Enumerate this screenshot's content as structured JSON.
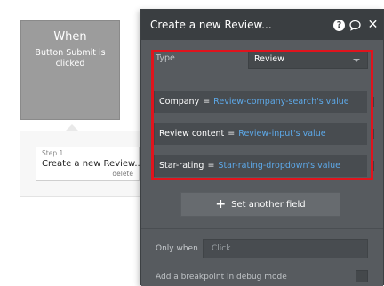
{
  "workflow": {
    "event_title": "When",
    "event_subtitle": "Button Submit is clicked",
    "step_label": "Step 1",
    "step_name": "Create a new Review...",
    "step_delete": "delete"
  },
  "panel": {
    "title": "Create a new Review...",
    "type_label": "Type",
    "type_value": "Review",
    "fields": [
      {
        "name": "Company",
        "eq": "=",
        "value": "Review-company-search's value"
      },
      {
        "name": "Review content",
        "eq": "=",
        "value": "Review-input's value"
      },
      {
        "name": "Star-rating",
        "eq": "=",
        "value": "Star-rating-dropdown's value"
      }
    ],
    "set_field_label": "Set another field",
    "only_when_label": "Only when",
    "only_when_placeholder": "Click",
    "breakpoint_label": "Add a breakpoint in debug mode"
  },
  "icons": {
    "help": "help-icon",
    "comment": "comment-icon",
    "close": "close-icon",
    "plus": "plus-icon"
  },
  "colors": {
    "panel_bg": "#575b5f",
    "header_bg": "#3a3e41",
    "value_blue": "#5da9e9",
    "highlight_red": "#e0141d"
  }
}
